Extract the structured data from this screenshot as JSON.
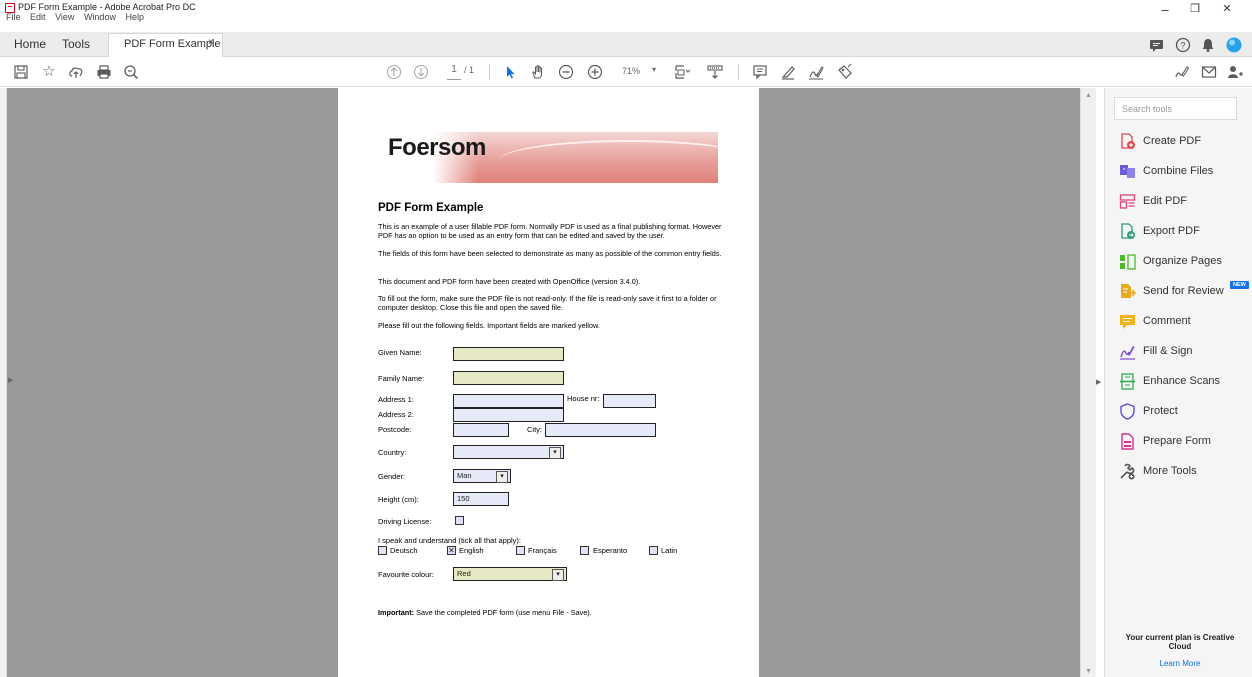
{
  "window": {
    "title": "PDF Form Example - Adobe Acrobat Pro DC",
    "menu": [
      "File",
      "Edit",
      "View",
      "Window",
      "Help"
    ],
    "controls": {
      "minimize": "–",
      "restore": "❐",
      "close": "✕"
    }
  },
  "tabs": {
    "home": "Home",
    "tools": "Tools",
    "document": "PDF Form Example",
    "close": "×"
  },
  "toolbar": {
    "page_current": "1",
    "page_total": "/ 1",
    "zoom": "71%"
  },
  "document": {
    "logo": "Foersom",
    "heading": "PDF Form Example",
    "paragraphs": [
      "This is an example of a user fillable PDF form. Normally PDF is used as a final publishing format. However PDF has an option to be used as an entry form that can be edited and saved by the user.",
      "The fields of this form have been selected to demonstrate as many as possible of the common entry fields.",
      "This document and PDF form have been created with OpenOffice (version 3.4.0).",
      "To fill out the form, make sure the PDF file is not read-only. If the file is read-only save it first to a folder or computer desktop. Close this file and open the saved file.",
      "Please fill out the following fields. Important fields are marked yellow."
    ],
    "form": {
      "given_name_label": "Given Name:",
      "family_name_label": "Family Name:",
      "address1_label": "Address 1:",
      "house_nr_label": "House nr:",
      "address2_label": "Address 2:",
      "postcode_label": "Postcode:",
      "city_label": "City:",
      "country_label": "Country:",
      "gender_label": "Gender:",
      "gender_value": "Man",
      "height_label": "Height (cm):",
      "height_value": "150",
      "driving_label": "Driving License:",
      "languages_label": "I speak and understand (tick all that apply):",
      "languages": [
        {
          "name": "Deutsch",
          "checked": false
        },
        {
          "name": "English",
          "checked": true
        },
        {
          "name": "Français",
          "checked": false
        },
        {
          "name": "Esperanto",
          "checked": false
        },
        {
          "name": "Latin",
          "checked": false
        }
      ],
      "checked_mark": "✕",
      "colour_label": "Favourite colour:",
      "colour_value": "Red"
    },
    "important_bold": "Important:",
    "important_text": " Save the completed PDF form (use menu File - Save)."
  },
  "tools_panel": {
    "search_placeholder": "Search tools",
    "items": [
      {
        "label": "Create PDF",
        "color": "#e34850"
      },
      {
        "label": "Combine Files",
        "color": "#6b5bd6"
      },
      {
        "label": "Edit PDF",
        "color": "#e0457b"
      },
      {
        "label": "Export PDF",
        "color": "#2d9d78"
      },
      {
        "label": "Organize Pages",
        "color": "#4fb82b"
      },
      {
        "label": "Send for Review",
        "color": "#e8a91a",
        "badge": "NEW"
      },
      {
        "label": "Comment",
        "color": "#f2b21a"
      },
      {
        "label": "Fill & Sign",
        "color": "#7a4fd6"
      },
      {
        "label": "Enhance Scans",
        "color": "#34a853"
      },
      {
        "label": "Protect",
        "color": "#5b4fd6"
      },
      {
        "label": "Prepare Form",
        "color": "#d6338f"
      },
      {
        "label": "More Tools",
        "color": "#555555"
      }
    ],
    "plan_text": "Your current plan is Creative Cloud",
    "learn_more": "Learn More"
  }
}
